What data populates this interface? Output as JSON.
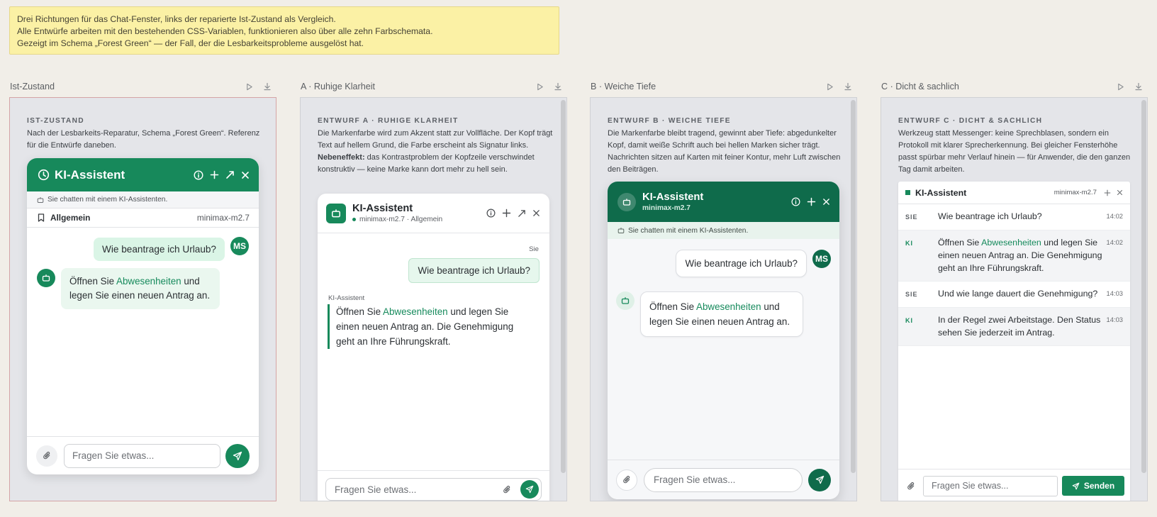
{
  "note": {
    "line1": "Drei Richtungen für das Chat-Fenster, links der reparierte Ist-Zustand als Vergleich.",
    "line2": "Alle Entwürfe arbeiten mit den bestehenden CSS-Variablen, funktionieren also über alle zehn Farbschemata.",
    "line3": "Gezeigt im Schema „Forest Green“ — der Fall, der die Lesbarkeitsprobleme ausgelöst hat."
  },
  "columns": [
    {
      "title": "Ist-Zustand"
    },
    {
      "title": "A · Ruhige Klarheit"
    },
    {
      "title": "B · Weiche Tiefe"
    },
    {
      "title": "C · Dicht & sachlich"
    }
  ],
  "colors": {
    "brand": "#17895b",
    "brand_dark": "#0f6b4b",
    "user_bubble": "#daf5e6",
    "note_bg": "#fbf1a5"
  },
  "ist": {
    "label": "IST-ZUSTAND",
    "desc": "Nach der Lesbarkeits-Reparatur, Schema „Forest Green“. Referenz für die Entwürfe daneben.",
    "title": "KI-Assistent",
    "notice": "Sie chatten mit einem KI-Assistenten.",
    "topic": "Allgemein",
    "model": "minimax-m2.7",
    "user_msg": "Wie beantrage ich Urlaub?",
    "initials": "MS",
    "ai_pre": "Öffnen Sie ",
    "ai_link": "Abwesenheiten",
    "ai_post": " und legen Sie einen neuen Antrag an.",
    "placeholder": "Fragen Sie etwas..."
  },
  "a": {
    "label": "ENTWURF A · RUHIGE KLARHEIT",
    "desc_pre": "Die Markenfarbe wird zum Akzent statt zur Vollfläche. Der Kopf trägt Text auf hellem Grund, die Farbe erscheint als Signatur links. ",
    "desc_bold": "Nebeneffekt:",
    "desc_post": " das Kontrastproblem der Kopfzeile verschwindet konstruktiv — keine Marke kann dort mehr zu hell sein.",
    "title": "KI-Assistent",
    "subtitle": "minimax-m2.7 · Allgemein",
    "user_label": "Sie",
    "user_msg": "Wie beantrage ich Urlaub?",
    "ai_label": "KI-Assistent",
    "ai_pre": "Öffnen Sie ",
    "ai_link": "Abwesenheiten",
    "ai_post": " und legen Sie einen neuen Antrag an. Die Genehmigung geht an Ihre Führungskraft.",
    "placeholder": "Fragen Sie etwas..."
  },
  "b": {
    "label": "ENTWURF B · WEICHE TIEFE",
    "desc": "Die Markenfarbe bleibt tragend, gewinnt aber Tiefe: abgedunkelter Kopf, damit weiße Schrift auch bei hellen Marken sicher trägt. Nachrichten sitzen auf Karten mit feiner Kontur, mehr Luft zwischen den Beiträgen.",
    "title": "KI-Assistent",
    "subtitle": "minimax-m2.7",
    "notice": "Sie chatten mit einem KI-Assistenten.",
    "user_msg": "Wie beantrage ich Urlaub?",
    "initials": "MS",
    "ai_pre": "Öffnen Sie ",
    "ai_link": "Abwesenheiten",
    "ai_post": " und legen Sie einen neuen Antrag an.",
    "placeholder": "Fragen Sie etwas..."
  },
  "c": {
    "label": "ENTWURF C · DICHT & SACHLICH",
    "desc": "Werkzeug statt Messenger: keine Sprechblasen, sondern ein Protokoll mit klarer Sprecherkennung. Bei gleicher Fensterhöhe passt spürbar mehr Verlauf hinein — für Anwender, die den ganzen Tag damit arbeiten.",
    "title": "KI-Assistent",
    "model": "minimax-m2.7",
    "messages": [
      {
        "who": "SIE",
        "text": "Wie beantrage ich Urlaub?",
        "time": "14:02"
      },
      {
        "who": "KI",
        "text_pre": "Öffnen Sie ",
        "link": "Abwesenheiten",
        "text_post": " und legen Sie einen neuen Antrag an. Die Genehmigung geht an Ihre Führungskraft.",
        "time": "14:02"
      },
      {
        "who": "SIE",
        "text": "Und wie lange dauert die Genehmigung?",
        "time": "14:03"
      },
      {
        "who": "KI",
        "text": "In der Regel zwei Arbeitstage. Den Status sehen Sie jederzeit im Antrag.",
        "time": "14:03"
      }
    ],
    "placeholder": "Fragen Sie etwas...",
    "send_label": "Senden"
  }
}
